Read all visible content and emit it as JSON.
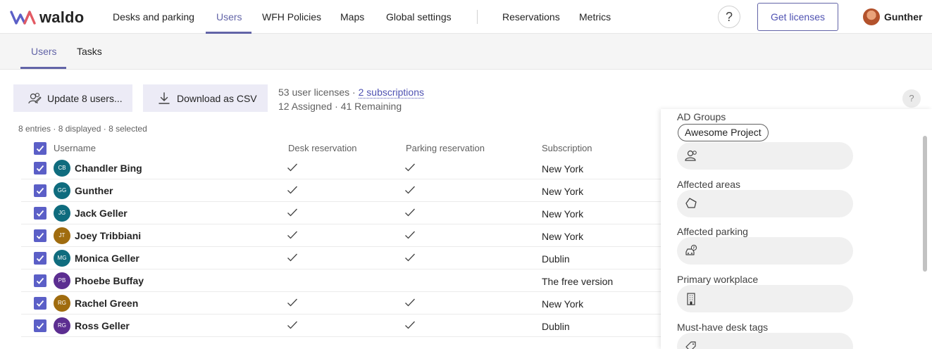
{
  "app": {
    "logo_text": "waldo",
    "brand_color": "#6264a7"
  },
  "topnav": {
    "items": [
      "Desks and parking",
      "Users",
      "WFH Policies",
      "Maps",
      "Global settings",
      "Reservations",
      "Metrics"
    ],
    "active": "Users",
    "help_label": "?",
    "get_licenses_label": "Get licenses",
    "user_name": "Gunther"
  },
  "subnav": {
    "tabs": [
      "Users",
      "Tasks"
    ],
    "active": "Users"
  },
  "actions": {
    "update_label": "Update 8 users...",
    "download_label": "Download as CSV"
  },
  "licenses": {
    "line1_prefix": "53 user licenses · ",
    "subscriptions_link": "2 subscriptions",
    "line2": "12 Assigned · 41 Remaining"
  },
  "help_small": "?",
  "table": {
    "summary": "8 entries · 8 displayed · 8 selected",
    "columns": [
      "Username",
      "Desk reservation",
      "Parking reservation",
      "Subscription"
    ],
    "rows": [
      {
        "initials": "CB",
        "name": "Chandler Bing",
        "avatar_color": "#0f6c7e",
        "desk": true,
        "parking": true,
        "subscription": "New York",
        "selected": true
      },
      {
        "initials": "GG",
        "name": "Gunther",
        "avatar_color": "#0f6c7e",
        "desk": true,
        "parking": true,
        "subscription": "New York",
        "selected": true
      },
      {
        "initials": "JG",
        "name": "Jack Geller",
        "avatar_color": "#0f6c7e",
        "desk": true,
        "parking": true,
        "subscription": "New York",
        "selected": true
      },
      {
        "initials": "JT",
        "name": "Joey Tribbiani",
        "avatar_color": "#a06c0f",
        "desk": true,
        "parking": true,
        "subscription": "New York",
        "selected": true
      },
      {
        "initials": "MG",
        "name": "Monica Geller",
        "avatar_color": "#0f6c7e",
        "desk": true,
        "parking": true,
        "subscription": "Dublin",
        "selected": true
      },
      {
        "initials": "PB",
        "name": "Phoebe Buffay",
        "avatar_color": "#5c2e91",
        "desk": false,
        "parking": false,
        "subscription": "The free version",
        "selected": true
      },
      {
        "initials": "RG",
        "name": "Rachel Green",
        "avatar_color": "#a06c0f",
        "desk": true,
        "parking": true,
        "subscription": "New York",
        "selected": true
      },
      {
        "initials": "RG",
        "name": "Ross Geller",
        "avatar_color": "#5c2e91",
        "desk": true,
        "parking": true,
        "subscription": "Dublin",
        "selected": true
      }
    ]
  },
  "panel": {
    "ad_groups_label": "AD Groups",
    "ad_group_tag": "Awesome Project",
    "affected_areas_label": "Affected areas",
    "affected_parking_label": "Affected parking",
    "primary_workplace_label": "Primary workplace",
    "desk_tags_label": "Must-have desk tags"
  }
}
